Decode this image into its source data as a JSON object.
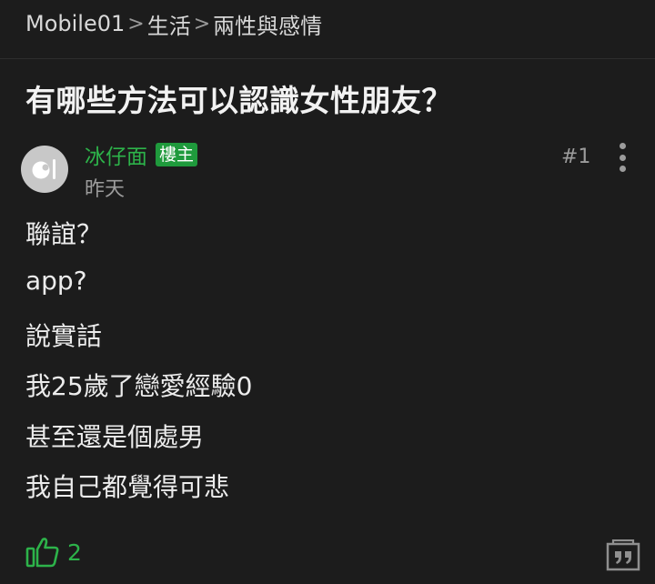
{
  "breadcrumb": {
    "site": "Mobile01",
    "separator": ">",
    "category": "生活",
    "forum": "兩性與感情"
  },
  "thread": {
    "title": "有哪些方法可以認識女性朋友？"
  },
  "post": {
    "author": "冰仔面",
    "author_badge": "樓主",
    "time": "昨天",
    "floor": "#1",
    "content_lines": [
      "聯誼？",
      "app?",
      "說實話",
      "我25歲了戀愛經驗0",
      "甚至還是個處男",
      "我自己都覺得可悲"
    ],
    "like_count": "2"
  },
  "icons": {
    "avatar": "avatar-placeholder-icon",
    "more": "more-vertical-icon",
    "like": "thumbs-up-icon",
    "quote": "quote-icon"
  },
  "colors": {
    "background": "#1c1c1c",
    "accent_green": "#2db34a",
    "badge_green": "#1f9a3c",
    "muted_text": "#9c9c9c"
  }
}
